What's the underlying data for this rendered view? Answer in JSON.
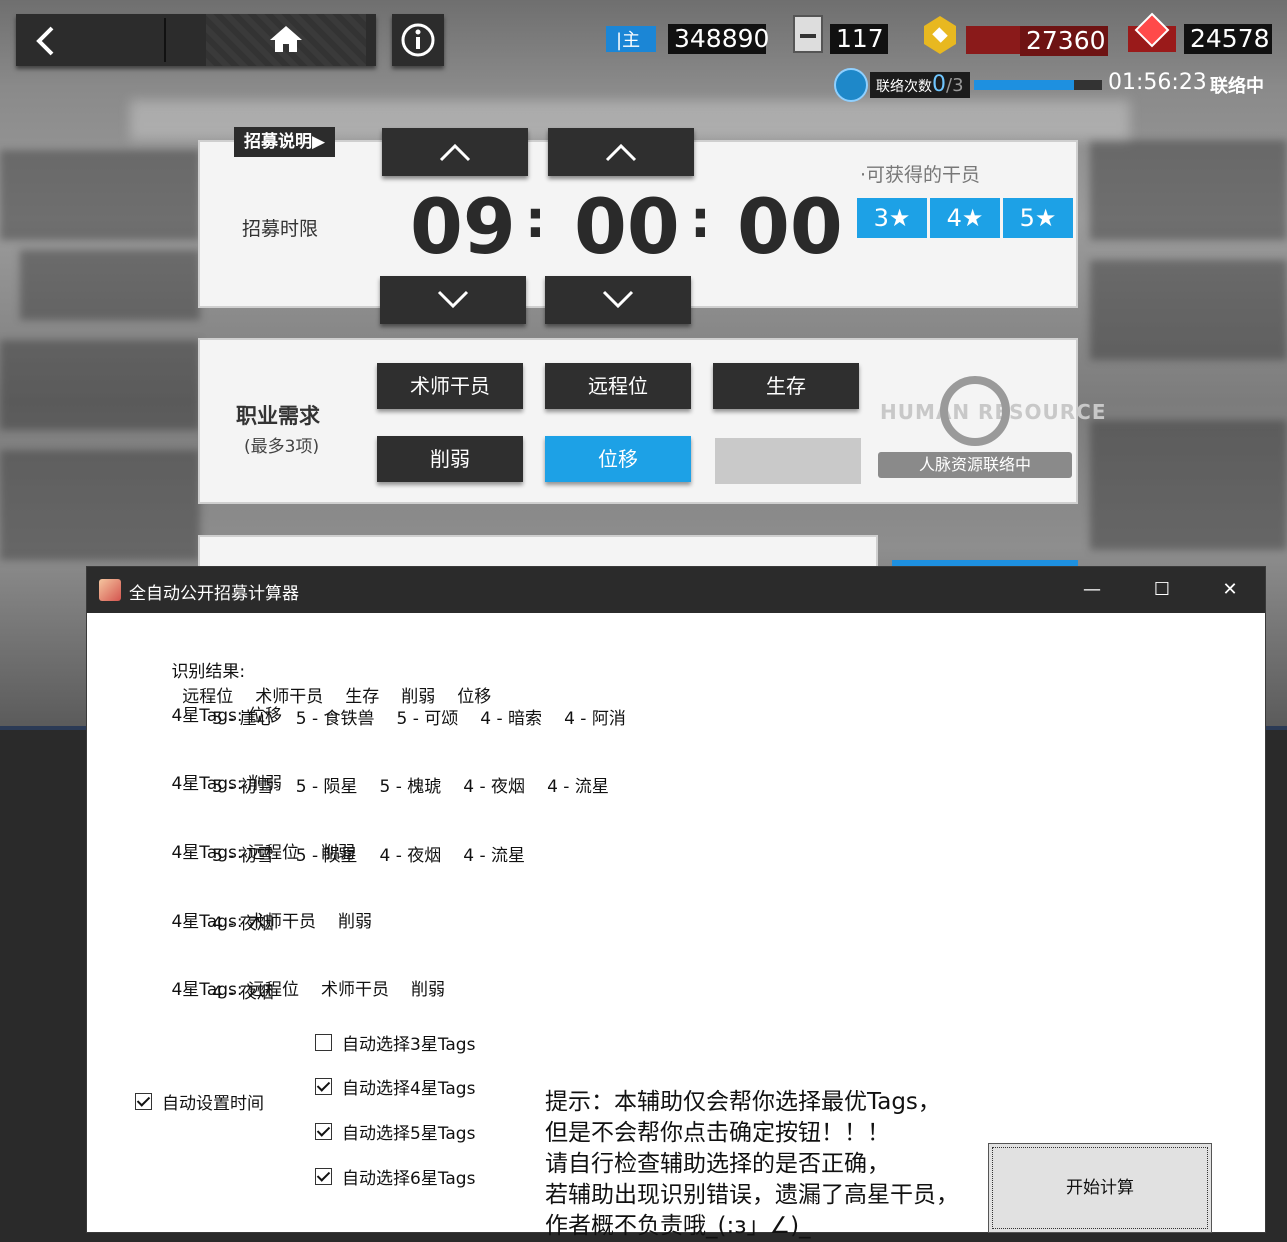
{
  "game": {
    "resources": {
      "recruit_permits": "348890",
      "expedited_plans": "117",
      "lmd_extra": "27360",
      "orundum": "24578"
    },
    "link": {
      "label": "联络次数",
      "count": "0",
      "max": "/3",
      "progress": 0.78,
      "time": "01:56:23",
      "status": "联络中"
    },
    "recruit_help": "招募说明▶",
    "time_label": "招募时限",
    "time": {
      "hours": "09",
      "minutes": "00",
      "seconds": "00",
      "sep": ":"
    },
    "available_label": "·可获得的干员",
    "stars": [
      "3★",
      "4★",
      "5★"
    ],
    "job_label": "职业需求",
    "job_sub": "(最多3项)",
    "tags": [
      {
        "label": "术师干员",
        "selected": false
      },
      {
        "label": "远程位",
        "selected": false
      },
      {
        "label": "生存",
        "selected": false
      },
      {
        "label": "削弱",
        "selected": false
      },
      {
        "label": "位移",
        "selected": true
      },
      {
        "label": "",
        "selected": false
      }
    ],
    "hr_link_button": "人脉资源联络中",
    "hr_logo": "HUMAN RESOURCE"
  },
  "window": {
    "title": "全自动公开招募计算器",
    "controls": {
      "min": "—",
      "max": "☐",
      "close": "✕"
    },
    "recognition_label": "识别结果:",
    "recognition_tags": [
      "远程位",
      "术师干员",
      "生存",
      "削弱",
      "位移"
    ],
    "results": [
      {
        "prefix": "4星Tags:",
        "tags": [
          "位移"
        ],
        "ops": [
          "5 - 崖心",
          "5 - 食铁兽",
          "5 - 可颂",
          "4 - 暗索",
          "4 - 阿消"
        ]
      },
      {
        "prefix": "4星Tags:",
        "tags": [
          "削弱"
        ],
        "ops": [
          "5 - 初雪",
          "5 - 陨星",
          "5 - 槐琥",
          "4 - 夜烟",
          "4 - 流星"
        ]
      },
      {
        "prefix": "4星Tags:",
        "tags": [
          "远程位",
          "削弱"
        ],
        "ops": [
          "5 - 初雪",
          "5 - 陨星",
          "4 - 夜烟",
          "4 - 流星"
        ]
      },
      {
        "prefix": "4星Tags:",
        "tags": [
          "术师干员",
          "削弱"
        ],
        "ops": [
          "4 - 夜烟"
        ]
      },
      {
        "prefix": "4星Tags:",
        "tags": [
          "远程位",
          "术师干员",
          "削弱"
        ],
        "ops": [
          "4 - 夜烟"
        ]
      }
    ],
    "auto_time": {
      "label": "自动设置时间",
      "checked": true
    },
    "auto_select": [
      {
        "label": "自动选择3星Tags",
        "checked": false
      },
      {
        "label": "自动选择4星Tags",
        "checked": true
      },
      {
        "label": "自动选择5星Tags",
        "checked": true
      },
      {
        "label": "自动选择6星Tags",
        "checked": true
      }
    ],
    "hint_lines": [
      "提示：本辅助仅会帮你选择最优Tags，",
      "但是不会帮你点击确定按钮！！！",
      "请自行检查辅助选择的是否正确，",
      "若辅助出现识别错误，遗漏了高星干员，",
      "作者概不负责哦_(:з」∠)_"
    ],
    "calc_button": "开始计算"
  }
}
